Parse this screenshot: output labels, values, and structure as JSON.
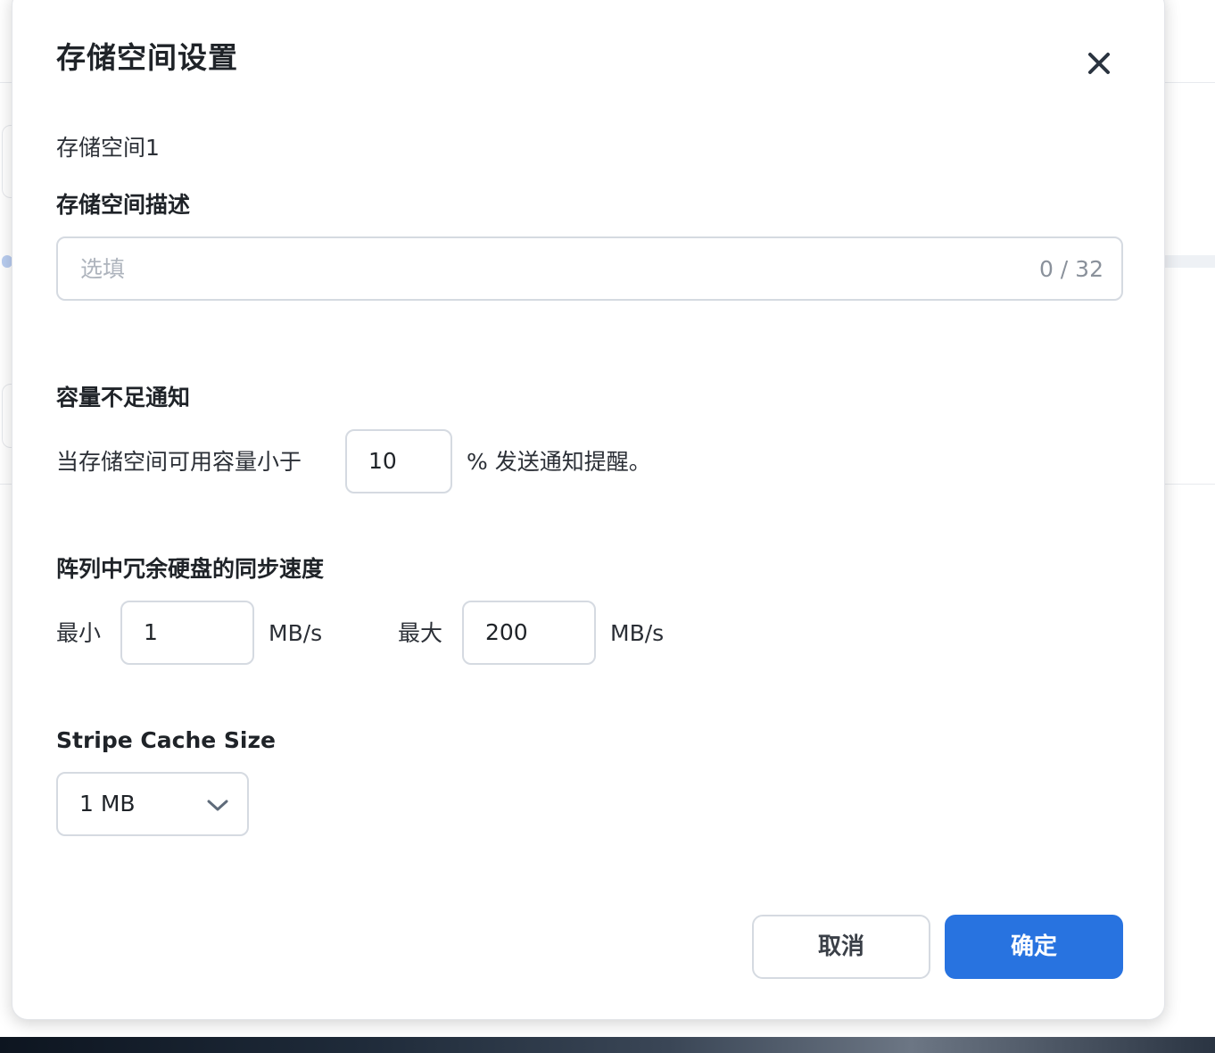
{
  "dialog": {
    "title": "存储空间设置",
    "subtitle": "存储空间1"
  },
  "description": {
    "label": "存储空间描述",
    "placeholder": "选填",
    "counter": "0 / 32"
  },
  "capacity_alert": {
    "label": "容量不足通知",
    "prefix": "当存储空间可用容量小于",
    "value": "10",
    "suffix": "% 发送通知提醒。"
  },
  "sync_speed": {
    "label": "阵列中冗余硬盘的同步速度",
    "min_label": "最小",
    "min_value": "1",
    "min_unit": "MB/s",
    "max_label": "最大",
    "max_value": "200",
    "max_unit": "MB/s"
  },
  "stripe_cache": {
    "label": "Stripe Cache Size",
    "selected": "1 MB"
  },
  "buttons": {
    "cancel": "取消",
    "confirm": "确定"
  },
  "icons": {
    "close": "close-icon",
    "dropdown": "chevron-down-icon"
  },
  "colors": {
    "primary": "#2873e0",
    "border": "#d5dae1",
    "text": "#1f2328"
  }
}
